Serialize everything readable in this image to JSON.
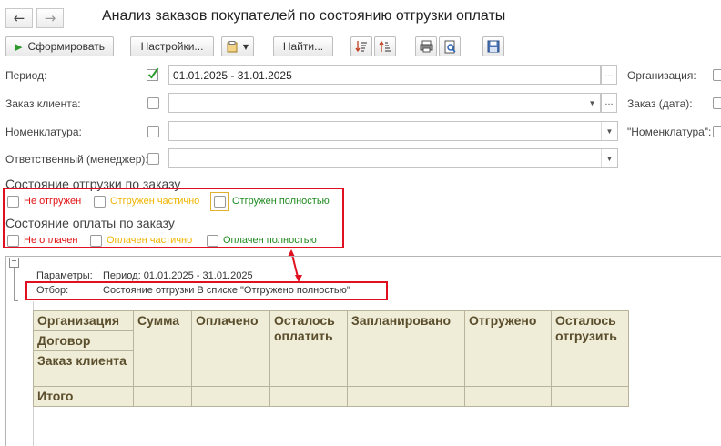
{
  "window": {
    "title": "Анализ заказов покупателей по состоянию отгрузки оплаты",
    "back_icon": "←",
    "forward_icon": "→"
  },
  "toolbar": {
    "generate_label": "Сформировать",
    "settings_label": "Настройки...",
    "find_label": "Найти..."
  },
  "form": {
    "period_label": "Период:",
    "period_value": "01.01.2025 - 31.01.2025",
    "order_label": "Заказ клиента:",
    "nomenclature_label": "Номенклатура:",
    "manager_label": "Ответственный (менеджер):",
    "organization_label": "Организация:",
    "order_date_label": "Заказ (дата):",
    "nomenclature_quoted_label": "\"Номенклатура\":",
    "ellipsis": "..."
  },
  "shipment": {
    "title": "Состояние отгрузки по заказу",
    "options": [
      {
        "label": "Не отгружен",
        "color": "#e01010"
      },
      {
        "label": "Отгружен частично",
        "color": "#f0b400"
      },
      {
        "label": "Отгружен полностью",
        "color": "#1f8a1f"
      }
    ]
  },
  "payment": {
    "title": "Состояние оплаты по заказу",
    "options": [
      {
        "label": "Не оплачен",
        "color": "#e01010"
      },
      {
        "label": "Оплачен частично",
        "color": "#f0b400"
      },
      {
        "label": "Оплачен полностью",
        "color": "#1f8a1f"
      }
    ]
  },
  "report": {
    "params_label": "Параметры:",
    "params_value": "Период: 01.01.2025 - 31.01.2025",
    "filter_label": "Отбор:",
    "filter_value": "Состояние отгрузки В списке \"Отгружено полностью\"",
    "columns": {
      "organization": "Организация",
      "contract": "Договор",
      "client_order": "Заказ клиента",
      "sum": "Сумма",
      "paid": "Оплачено",
      "left_to_pay": "Осталось оплатить",
      "planned": "Запланировано",
      "shipped": "Отгружено",
      "left_to_ship": "Осталось отгрузить"
    },
    "total_label": "Итого"
  }
}
